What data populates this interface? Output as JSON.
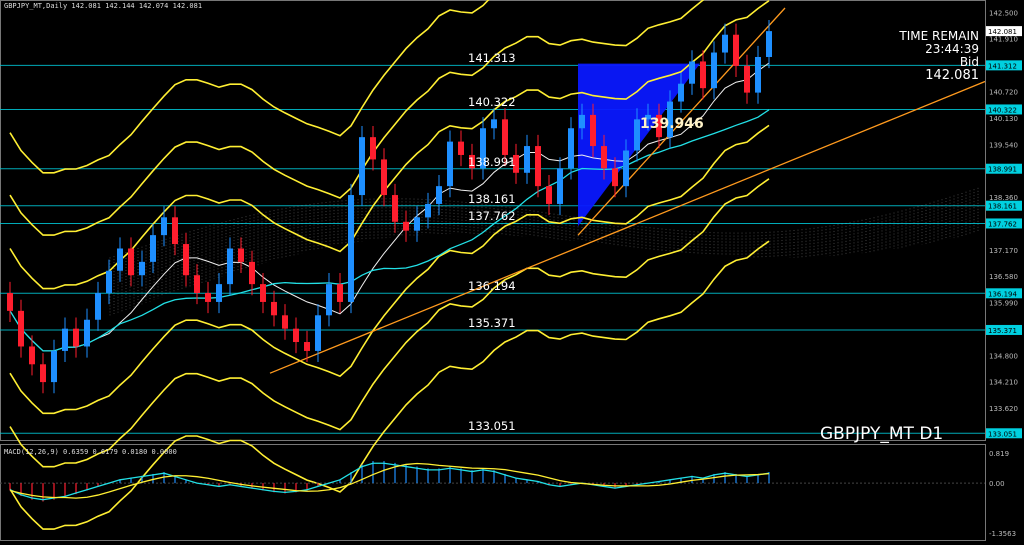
{
  "header": {
    "title_line": "GBPJPY_MT,Daily  142.081 142.144 142.074 142.081"
  },
  "time_remain": {
    "label": "TIME REMAIN",
    "value": "23:44:39",
    "bid_label": "Bid",
    "bid_value": "142.081"
  },
  "symbol_label": "GBPJPY_MT D1",
  "level_tags": [
    {
      "text": "141.313",
      "price": 141.313
    },
    {
      "text": "140.322",
      "price": 140.322
    },
    {
      "text": "138.991",
      "price": 138.991
    },
    {
      "text": "138.161",
      "price": 138.161
    },
    {
      "text": "137.762",
      "price": 137.762
    },
    {
      "text": "136.194",
      "price": 136.194
    },
    {
      "text": "135.371",
      "price": 135.371
    },
    {
      "text": "133.051",
      "price": 133.051
    }
  ],
  "highlight_tag": {
    "text": "139.946",
    "price": 139.946
  },
  "price_axis": {
    "ticks": [
      "142.500",
      "141.910",
      "140.720",
      "140.130",
      "139.540",
      "138.360",
      "137.170",
      "136.580",
      "135.990",
      "134.800",
      "134.210",
      "133.620"
    ],
    "min": 132.9,
    "max": 142.6
  },
  "price_boxes": [
    {
      "text": "142.081",
      "price": 142.081,
      "bg": "#ffffff",
      "fg": "#000000"
    },
    {
      "text": "141.312",
      "price": 141.312,
      "bg": "#00d0e0",
      "fg": "#000000"
    },
    {
      "text": "140.322",
      "price": 140.322,
      "bg": "#00d0e0",
      "fg": "#000000"
    },
    {
      "text": "138.991",
      "price": 138.991,
      "bg": "#00d0e0",
      "fg": "#000000"
    },
    {
      "text": "138.161",
      "price": 138.161,
      "bg": "#00d0e0",
      "fg": "#000000"
    },
    {
      "text": "137.762",
      "price": 137.762,
      "bg": "#00d0e0",
      "fg": "#000000"
    },
    {
      "text": "136.194",
      "price": 136.194,
      "bg": "#00d0e0",
      "fg": "#000000"
    },
    {
      "text": "135.371",
      "price": 135.371,
      "bg": "#00d0e0",
      "fg": "#000000"
    },
    {
      "text": "133.051",
      "price": 133.051,
      "bg": "#00d0e0",
      "fg": "#000000"
    }
  ],
  "macd": {
    "title": "MACD(12,26,9) 0.6359 0.6179 0.0180 0.0000",
    "ticks": [
      "0.819",
      "0.00",
      "-1.3563"
    ],
    "min": -1.3563,
    "max": 0.819
  },
  "colors": {
    "up": "#1e8fff",
    "down": "#ff1e2e",
    "level": "#00c8d8",
    "bands": "#ffef33",
    "trend": "#ff9a1e",
    "fill": "#0a18ff",
    "ma": "#22e0e6"
  },
  "chart_data": {
    "type": "candlestick",
    "closes": [
      135.8,
      135.0,
      134.6,
      134.2,
      134.9,
      135.4,
      135.0,
      135.6,
      136.2,
      136.7,
      137.2,
      136.6,
      136.9,
      137.5,
      137.9,
      137.3,
      136.6,
      136.2,
      136.0,
      136.4,
      137.2,
      136.9,
      136.4,
      136.0,
      135.7,
      135.4,
      135.1,
      134.9,
      135.7,
      136.4,
      136.0,
      138.4,
      139.7,
      139.2,
      138.4,
      137.8,
      137.6,
      137.9,
      138.2,
      138.6,
      139.6,
      139.3,
      139.0,
      139.9,
      140.1,
      139.3,
      138.9,
      139.5,
      138.6,
      138.2,
      139.0,
      139.9,
      140.2,
      139.5,
      139.0,
      138.6,
      139.4,
      140.1,
      140.2,
      139.7,
      140.5,
      140.9,
      141.4,
      140.8,
      141.6,
      142.0,
      141.3,
      140.7,
      141.5,
      142.081
    ],
    "macd_hist": [
      -0.2,
      -0.35,
      -0.45,
      -0.5,
      -0.45,
      -0.4,
      -0.3,
      -0.2,
      -0.1,
      0.0,
      0.1,
      0.15,
      0.2,
      0.25,
      0.3,
      0.2,
      0.1,
      0.0,
      -0.05,
      -0.1,
      -0.05,
      -0.1,
      -0.15,
      -0.2,
      -0.25,
      -0.28,
      -0.25,
      -0.2,
      -0.1,
      0.0,
      0.1,
      0.3,
      0.5,
      0.6,
      0.6,
      0.55,
      0.5,
      0.45,
      0.4,
      0.4,
      0.45,
      0.4,
      0.35,
      0.4,
      0.35,
      0.25,
      0.15,
      0.1,
      0.05,
      -0.05,
      -0.1,
      -0.05,
      0.0,
      -0.05,
      -0.1,
      -0.15,
      -0.1,
      -0.05,
      0.0,
      0.05,
      0.1,
      0.15,
      0.2,
      0.15,
      0.25,
      0.3,
      0.25,
      0.2,
      0.25,
      0.3
    ]
  }
}
